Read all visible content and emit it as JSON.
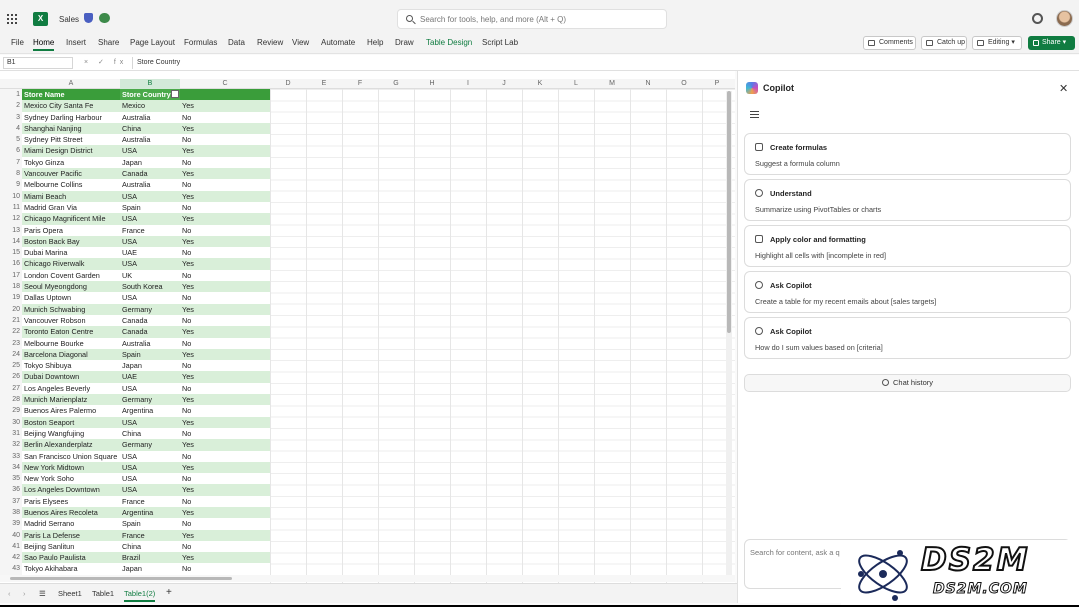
{
  "app": {
    "file_name": "Sales",
    "app_logo_letter": "X"
  },
  "search": {
    "placeholder": "Search for tools, help, and more (Alt + Q)"
  },
  "ribbon": {
    "tabs": [
      "File",
      "Home",
      "Insert",
      "Share",
      "Page Layout",
      "Formulas",
      "Data",
      "Review",
      "View",
      "Automate",
      "Help",
      "Draw",
      "Table Design",
      "Script Lab"
    ],
    "active_tab": "Home",
    "comments_label": "Comments",
    "catchup_label": "Catch up",
    "editing_label": "Editing",
    "share_label": "Share"
  },
  "formula_bar": {
    "name_box": "B1",
    "fx_icons": "× ✓ fx",
    "content": "Store Country"
  },
  "grid": {
    "columns": [
      "A",
      "B",
      "C",
      "D",
      "E",
      "F",
      "G",
      "H",
      "I",
      "J",
      "K",
      "L",
      "M",
      "N",
      "O",
      "P"
    ],
    "selected_column": "B",
    "headers": [
      "Store Name",
      "Store Country",
      ""
    ],
    "rows": [
      [
        "Mexico City Santa Fe",
        "Mexico",
        "Yes"
      ],
      [
        "Sydney Darling Harbour",
        "Australia",
        "No"
      ],
      [
        "Shanghai Nanjing",
        "China",
        "Yes"
      ],
      [
        "Sydney Pitt Street",
        "Australia",
        "No"
      ],
      [
        "Miami Design District",
        "USA",
        "Yes"
      ],
      [
        "Tokyo Ginza",
        "Japan",
        "No"
      ],
      [
        "Vancouver Pacific",
        "Canada",
        "Yes"
      ],
      [
        "Melbourne Collins",
        "Australia",
        "No"
      ],
      [
        "Miami Beach",
        "USA",
        "Yes"
      ],
      [
        "Madrid Gran Via",
        "Spain",
        "No"
      ],
      [
        "Chicago Magnificent Mile",
        "USA",
        "Yes"
      ],
      [
        "Paris Opera",
        "France",
        "No"
      ],
      [
        "Boston Back Bay",
        "USA",
        "Yes"
      ],
      [
        "Dubai Marina",
        "UAE",
        "No"
      ],
      [
        "Chicago Riverwalk",
        "USA",
        "Yes"
      ],
      [
        "London Covent Garden",
        "UK",
        "No"
      ],
      [
        "Seoul Myeongdong",
        "South Korea",
        "Yes"
      ],
      [
        "Dallas Uptown",
        "USA",
        "No"
      ],
      [
        "Munich Schwabing",
        "Germany",
        "Yes"
      ],
      [
        "Vancouver Robson",
        "Canada",
        "No"
      ],
      [
        "Toronto Eaton Centre",
        "Canada",
        "Yes"
      ],
      [
        "Melbourne Bourke",
        "Australia",
        "No"
      ],
      [
        "Barcelona Diagonal",
        "Spain",
        "Yes"
      ],
      [
        "Tokyo Shibuya",
        "Japan",
        "No"
      ],
      [
        "Dubai Downtown",
        "UAE",
        "Yes"
      ],
      [
        "Los Angeles Beverly",
        "USA",
        "No"
      ],
      [
        "Munich Marienplatz",
        "Germany",
        "Yes"
      ],
      [
        "Buenos Aires Palermo",
        "Argentina",
        "No"
      ],
      [
        "Boston Seaport",
        "USA",
        "Yes"
      ],
      [
        "Beijing Wangfujing",
        "China",
        "No"
      ],
      [
        "Berlin Alexanderplatz",
        "Germany",
        "Yes"
      ],
      [
        "San Francisco Union Square",
        "USA",
        "No"
      ],
      [
        "New York Midtown",
        "USA",
        "Yes"
      ],
      [
        "New York Soho",
        "USA",
        "No"
      ],
      [
        "Los Angeles Downtown",
        "USA",
        "Yes"
      ],
      [
        "Paris Elysees",
        "France",
        "No"
      ],
      [
        "Buenos Aires Recoleta",
        "Argentina",
        "Yes"
      ],
      [
        "Madrid Serrano",
        "Spain",
        "No"
      ],
      [
        "Paris La Defense",
        "France",
        "Yes"
      ],
      [
        "Beijing Sanlitun",
        "China",
        "No"
      ],
      [
        "Sao Paulo Paulista",
        "Brazil",
        "Yes"
      ],
      [
        "Tokyo Akihabara",
        "Japan",
        "No"
      ]
    ]
  },
  "sheets": [
    "Sheet1",
    "Table1",
    "Table1(2)"
  ],
  "active_sheet": "Table1(2)",
  "copilot": {
    "title": "Copilot",
    "cards": [
      {
        "title": "Create formulas",
        "subtitle": "Suggest a formula column"
      },
      {
        "title": "Understand",
        "subtitle": "Summarize using PivotTables or charts"
      },
      {
        "title": "Apply color and formatting",
        "subtitle": "Highlight all cells with [incomplete in red]"
      },
      {
        "title": "Ask Copilot",
        "subtitle": "Create a table for my recent emails about [sales targets]"
      },
      {
        "title": "Ask Copilot",
        "subtitle": "How do I sum values based on [criteria]"
      }
    ],
    "chat_history_label": "Chat history",
    "input_placeholder": "Search for content, ask a q"
  },
  "watermark": {
    "big": "DS2M",
    "small": "DS2M.COM"
  },
  "colors": {
    "accent": "#107c41",
    "table_header": "#3a9d3a",
    "band": "#d9efd9"
  }
}
